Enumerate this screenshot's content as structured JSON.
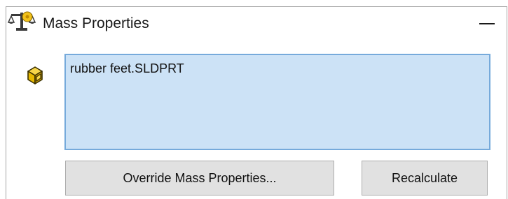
{
  "panel": {
    "title": "Mass Properties",
    "title_icon": "balance-scale-icon",
    "collapse_icon": "collapse-icon"
  },
  "selection": {
    "icon": "part-icon",
    "items": [
      "rubber feet.SLDPRT"
    ]
  },
  "buttons": {
    "override_label": "Override Mass Properties...",
    "recalculate_label": "Recalculate"
  }
}
